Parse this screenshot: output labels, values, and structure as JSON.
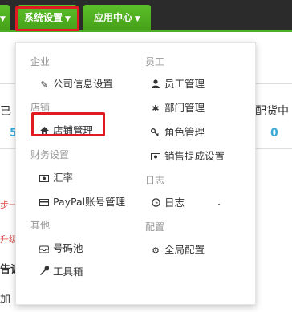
{
  "topnav": {
    "system_label": "系统设置",
    "apps_label": "应用中心"
  },
  "background": {
    "left_text_1": "已",
    "left_num_1": "5",
    "right_text_1": "配货中",
    "right_num_1": "0",
    "left_red_1": "步一",
    "left_red_2": "升级",
    "left_text_2": "告诉",
    "left_text_3": "加"
  },
  "menu": {
    "enterprise": {
      "heading": "企业",
      "items": [
        "公司信息设置"
      ]
    },
    "store": {
      "heading": "店铺",
      "items": [
        "店铺管理"
      ]
    },
    "finance": {
      "heading": "财务设置",
      "items": [
        "汇率",
        "PayPal账号管理"
      ]
    },
    "other": {
      "heading": "其他",
      "items": [
        "号码池",
        "工具箱"
      ]
    },
    "staff": {
      "heading": "员工",
      "items": [
        "员工管理",
        "部门管理",
        "角色管理",
        "销售提成设置"
      ]
    },
    "log": {
      "heading": "日志",
      "items": [
        "日志"
      ]
    },
    "config": {
      "heading": "配置",
      "items": [
        "全局配置"
      ]
    }
  },
  "colors": {
    "nav_green": "#4caf27",
    "highlight_red": "#e11b22",
    "accent_blue": "#3aa9d8"
  }
}
